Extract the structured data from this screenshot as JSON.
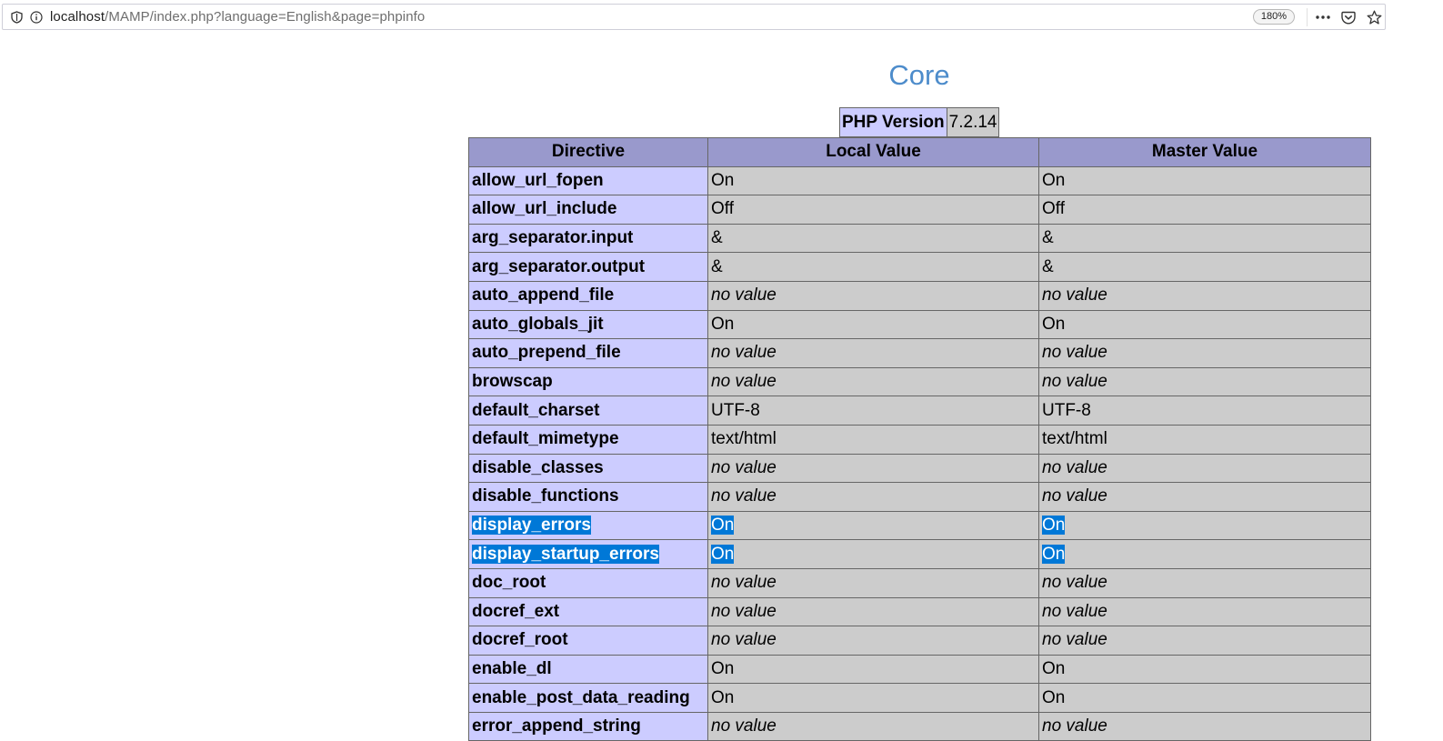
{
  "browser": {
    "url_host": "localhost",
    "url_path": "/MAMP/index.php?language=English&page=phpinfo",
    "zoom": "180%"
  },
  "page": {
    "section_title": "Core",
    "version_label": "PHP Version",
    "version_value": "7.2.14"
  },
  "table": {
    "headers": [
      "Directive",
      "Local Value",
      "Master Value"
    ],
    "rows": [
      {
        "directive": "allow_url_fopen",
        "local": "On",
        "master": "On"
      },
      {
        "directive": "allow_url_include",
        "local": "Off",
        "master": "Off"
      },
      {
        "directive": "arg_separator.input",
        "local": "&",
        "master": "&"
      },
      {
        "directive": "arg_separator.output",
        "local": "&",
        "master": "&"
      },
      {
        "directive": "auto_append_file",
        "local": "no value",
        "master": "no value"
      },
      {
        "directive": "auto_globals_jit",
        "local": "On",
        "master": "On"
      },
      {
        "directive": "auto_prepend_file",
        "local": "no value",
        "master": "no value"
      },
      {
        "directive": "browscap",
        "local": "no value",
        "master": "no value"
      },
      {
        "directive": "default_charset",
        "local": "UTF-8",
        "master": "UTF-8"
      },
      {
        "directive": "default_mimetype",
        "local": "text/html",
        "master": "text/html"
      },
      {
        "directive": "disable_classes",
        "local": "no value",
        "master": "no value"
      },
      {
        "directive": "disable_functions",
        "local": "no value",
        "master": "no value"
      },
      {
        "directive": "display_errors",
        "local": "On",
        "master": "On"
      },
      {
        "directive": "display_startup_errors",
        "local": "On",
        "master": "On"
      },
      {
        "directive": "doc_root",
        "local": "no value",
        "master": "no value"
      },
      {
        "directive": "docref_ext",
        "local": "no value",
        "master": "no value"
      },
      {
        "directive": "docref_root",
        "local": "no value",
        "master": "no value"
      },
      {
        "directive": "enable_dl",
        "local": "On",
        "master": "On"
      },
      {
        "directive": "enable_post_data_reading",
        "local": "On",
        "master": "On"
      },
      {
        "directive": "error_append_string",
        "local": "no value",
        "master": "no value"
      }
    ]
  },
  "colors": {
    "title": "#4d8ccb",
    "header_bg": "#9999cc",
    "directive_bg": "#ccccff",
    "value_bg": "#cccccc",
    "selection": "#0078d7"
  }
}
